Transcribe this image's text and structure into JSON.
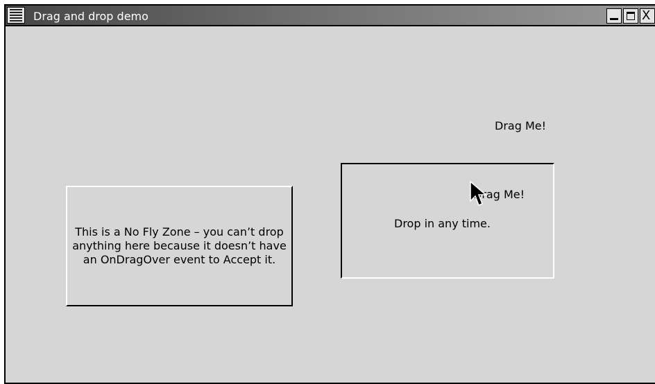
{
  "window": {
    "title": "Drag and drop demo"
  },
  "title_buttons": {
    "minimize_icon": "minimize-icon",
    "maximize_icon": "maximize-icon",
    "close_glyph": "X"
  },
  "content": {
    "drag_source_label": "Drag Me!",
    "no_fly_zone_text": "This is a No Fly Zone – you can’t drop anything here because it doesn’t have an OnDragOver event to Accept it.",
    "drop_zone_text": "Drop in any time.",
    "dropped_label": "Drag Me!"
  },
  "colors": {
    "background": "#d6d6d6",
    "titlebar_start": "#464646",
    "titlebar_end": "#9a9a9a",
    "title_text": "#ffffff"
  }
}
